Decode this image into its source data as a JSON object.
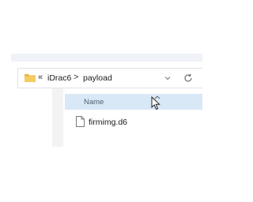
{
  "address_bar": {
    "overflow_glyph": "«",
    "breadcrumbs": [
      "iDrac6",
      "payload"
    ],
    "separator": ">",
    "folder_icon": "folder-icon",
    "dropdown_icon": "chevron-down-icon",
    "refresh_icon": "refresh-icon"
  },
  "file_list": {
    "columns": [
      {
        "label": "Name",
        "sort_icon": "sort-up-icon"
      }
    ],
    "rows": [
      {
        "name": "firmimg.d6",
        "icon": "file-icon"
      }
    ]
  },
  "colors": {
    "header_selected": "#d9e8f7",
    "folder": "#f0c15c",
    "pane_bg": "#f3f3f3"
  }
}
